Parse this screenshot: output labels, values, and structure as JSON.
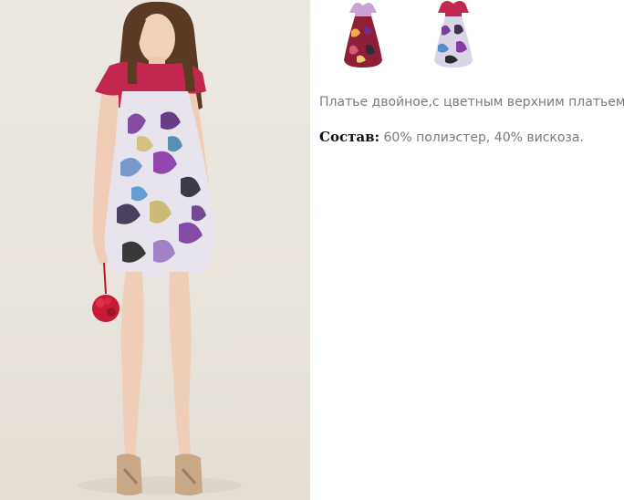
{
  "product": {
    "description": "Платье двойное,с цветным верхним платьем.",
    "composition_label": "Состав:",
    "composition_value": " 60% полиэстер, 40% вискоза."
  },
  "thumbnails": [
    {
      "icon": "dress-red-print-thumbnail"
    },
    {
      "icon": "dress-purple-print-thumbnail"
    }
  ],
  "colors": {
    "text_gray": "#7a7a7a",
    "label_black": "#111111",
    "photo_background": "#ece8e1",
    "dress_top_pink": "#c2274f",
    "print_purple": "#7b3f9e"
  }
}
